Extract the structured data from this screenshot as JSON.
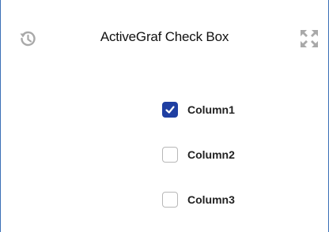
{
  "widget": {
    "title": "ActiveGraf Check Box",
    "header_icons": [
      "history-icon",
      "expand-icon"
    ]
  },
  "options": [
    {
      "label": "Column1",
      "checked": true
    },
    {
      "label": "Column2",
      "checked": false
    },
    {
      "label": "Column3",
      "checked": false
    }
  ],
  "colors": {
    "checked_fill": "#1f3fa2",
    "unchecked_border": "#b8b8b8",
    "frame_border": "#3b6fb6",
    "icon_gray": "#a9a9a9"
  }
}
